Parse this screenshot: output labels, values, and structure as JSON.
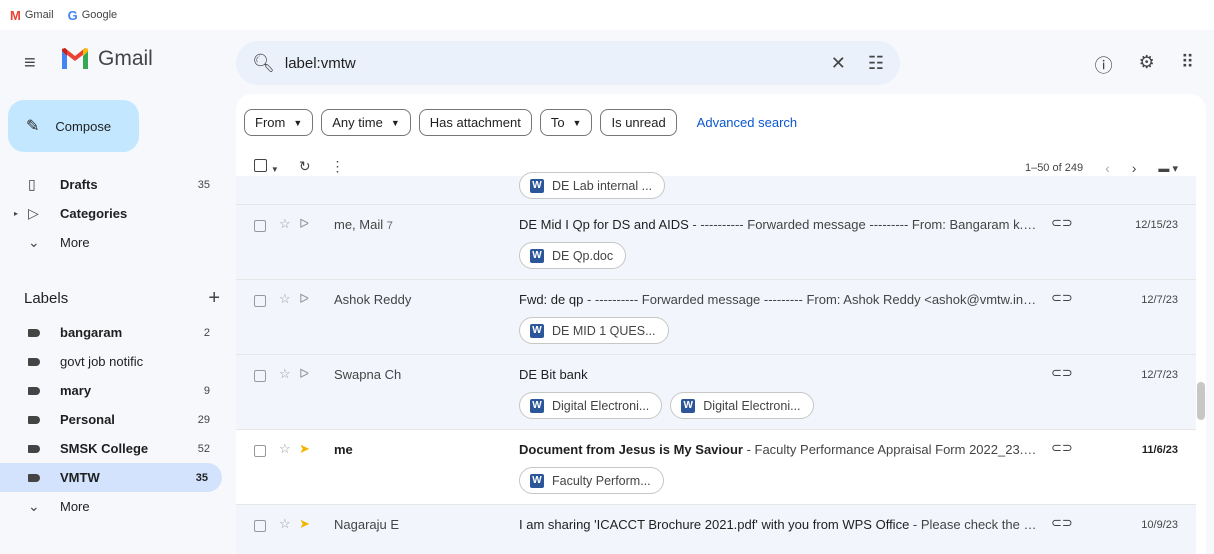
{
  "bookmarks": [
    {
      "label": "Gmail",
      "icon": "M",
      "color": "#ea4335"
    },
    {
      "label": "Google",
      "icon": "G",
      "color": "#4285f4"
    }
  ],
  "header": {
    "app_name": "Gmail",
    "search_value": "label:vmtw"
  },
  "compose_label": "Compose",
  "nav": [
    {
      "label": "Drafts",
      "count": "35",
      "icon": "draft-icon"
    },
    {
      "label": "Categories",
      "count": "",
      "icon": "label-outline-icon"
    },
    {
      "label": "More",
      "count": "",
      "icon": "chevron-down-icon"
    }
  ],
  "labels_title": "Labels",
  "labels": [
    {
      "label": "bangaram",
      "count": "2",
      "bold": true
    },
    {
      "label": "govt job notific",
      "count": "",
      "bold": false
    },
    {
      "label": "mary",
      "count": "9",
      "bold": true
    },
    {
      "label": "Personal",
      "count": "29",
      "bold": true
    },
    {
      "label": "SMSK College",
      "count": "52",
      "bold": true
    },
    {
      "label": "VMTW",
      "count": "35",
      "bold": true
    },
    {
      "label": "More",
      "count": "",
      "bold": false
    }
  ],
  "filters": {
    "from": "From",
    "any_time": "Any time",
    "has_attachment": "Has attachment",
    "to": "To",
    "is_unread": "Is unread",
    "advanced": "Advanced search"
  },
  "pager": "1–50 of 249",
  "emails": [
    {
      "sender": "",
      "count": "",
      "subject": "",
      "preview": "",
      "date": "",
      "attachments": [
        "DE Lab internal ..."
      ],
      "unread": false
    },
    {
      "sender": "me, Mail",
      "count": "7",
      "subject": "DE Mid I Qp for DS and AIDS",
      "preview": " - ---------- Forwarded message --------- From: Bangaram k.j <ban...",
      "date": "12/15/23",
      "attachments": [
        "DE Qp.doc"
      ],
      "unread": false
    },
    {
      "sender": "Ashok Reddy",
      "count": "",
      "subject": "Fwd: de qp",
      "preview": " - ---------- Forwarded message --------- From: Ashok Reddy <ashok@vmtw.in> Dat...",
      "date": "12/7/23",
      "attachments": [
        "DE MID 1 QUES..."
      ],
      "unread": false
    },
    {
      "sender": "Swapna Ch",
      "count": "",
      "subject": "DE Bit bank",
      "preview": "",
      "date": "12/7/23",
      "attachments": [
        "Digital Electroni...",
        "Digital Electroni..."
      ],
      "unread": false
    },
    {
      "sender": "me",
      "count": "",
      "subject": "Document from Jesus is My Saviour",
      "preview": " - Faculty Performance Appraisal Form 2022_23.docx",
      "date": "11/6/23",
      "attachments": [
        "Faculty Perform..."
      ],
      "unread": true
    },
    {
      "sender": "Nagaraju E",
      "count": "",
      "subject": "I am sharing 'ICACCT Brochure 2021.pdf' with you from WPS Office",
      "preview": " - Please check the attachm...",
      "date": "10/9/23",
      "attachments": [],
      "unread": false
    }
  ]
}
